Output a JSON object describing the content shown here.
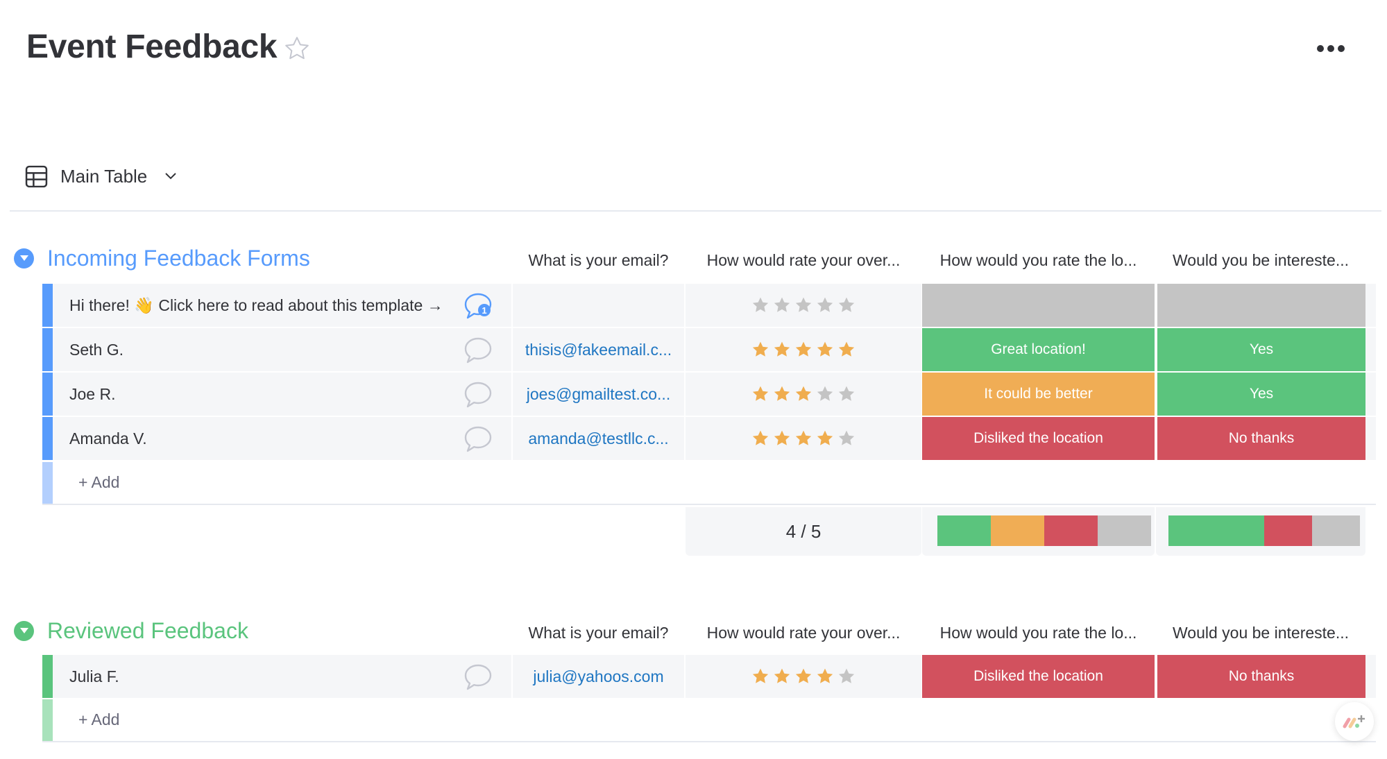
{
  "board": {
    "title": "Event Feedback",
    "favorite_icon": "star-outline-icon",
    "more_icon": "more-dots-icon"
  },
  "view": {
    "label": "Main Table",
    "icon": "table-icon",
    "dropdown_icon": "chevron-down-icon"
  },
  "colors": {
    "group1": "#579bfc",
    "group1_light": "#b3cffd",
    "group2": "#5ac47d",
    "group2_light": "#a8e2bb",
    "green": "#5bc47d",
    "orange": "#f0ad55",
    "red": "#d2515e",
    "grey": "#c4c4c4",
    "star_on": "#f0ad4e",
    "star_off": "#c4c4c4",
    "link": "#1f76c2"
  },
  "columns": {
    "email": "What is your email?",
    "rating": "How would rate your over...",
    "location": "How would you rate the lo...",
    "interested": "Would you be intereste..."
  },
  "groups": [
    {
      "title": "Incoming Feedback Forms",
      "add_label": "+ Add",
      "rows": [
        {
          "name": "Hi there! 👋 Click here to read about this template →",
          "comments": 1,
          "email": "",
          "rating": 0,
          "location": "",
          "location_color": "grey",
          "interested": "",
          "interested_color": "grey"
        },
        {
          "name": "Seth G.",
          "comments": 0,
          "email": "thisis@fakeemail.c...",
          "rating": 5,
          "location": "Great location!",
          "location_color": "green",
          "interested": "Yes",
          "interested_color": "green"
        },
        {
          "name": "Joe R.",
          "comments": 0,
          "email": "joes@gmailtest.co...",
          "rating": 3,
          "location": "It could be better",
          "location_color": "orange",
          "interested": "Yes",
          "interested_color": "green"
        },
        {
          "name": "Amanda V.",
          "comments": 0,
          "email": "amanda@testllc.c...",
          "rating": 4,
          "location": "Disliked the location",
          "location_color": "red",
          "interested": "No thanks",
          "interested_color": "red"
        }
      ],
      "summary": {
        "rating_text": "4 / 5",
        "location_distribution": [
          {
            "status": "Great location!",
            "color": "green",
            "fraction": 0.25
          },
          {
            "status": "It could be better",
            "color": "orange",
            "fraction": 0.25
          },
          {
            "status": "Disliked the location",
            "color": "red",
            "fraction": 0.25
          },
          {
            "status": "",
            "color": "grey",
            "fraction": 0.25
          }
        ],
        "interested_distribution": [
          {
            "status": "Yes",
            "color": "green",
            "fraction": 0.5
          },
          {
            "status": "No thanks",
            "color": "red",
            "fraction": 0.25
          },
          {
            "status": "",
            "color": "grey",
            "fraction": 0.25
          }
        ]
      }
    },
    {
      "title": "Reviewed Feedback",
      "add_label": "+ Add",
      "rows": [
        {
          "name": "Julia F.",
          "comments": 0,
          "email": "julia@yahoos.com",
          "rating": 4,
          "location": "Disliked the location",
          "location_color": "red",
          "interested": "No thanks",
          "interested_color": "red"
        }
      ]
    }
  ],
  "floating_button": {
    "icon": "monday-logo-plus-icon"
  }
}
